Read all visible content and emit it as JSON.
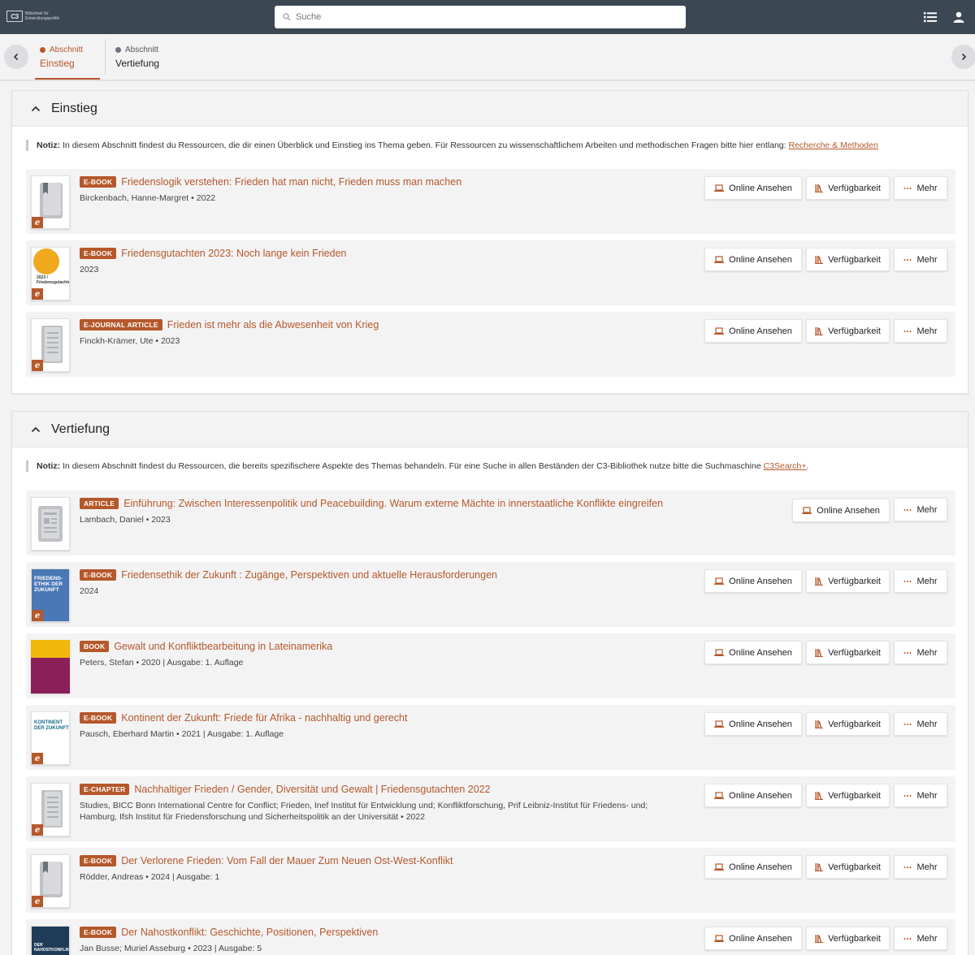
{
  "header": {
    "logo_mark": "C3",
    "logo_text": "Bibliothek für Entwicklungspolitik",
    "search_placeholder": "Suche"
  },
  "section_nav": {
    "tabs": [
      {
        "small": "Abschnitt",
        "label": "Einstieg",
        "dot_color": "#b5582a"
      },
      {
        "small": "Abschnitt",
        "label": "Vertiefung",
        "dot_color": "#6b7380"
      }
    ]
  },
  "buttons": {
    "online": "Online Ansehen",
    "availability": "Verfügbarkeit",
    "more": "Mehr"
  },
  "sections": [
    {
      "title": "Einstieg",
      "note_label": "Notiz:",
      "note_text": " In diesem Abschnitt findest du Ressourcen, die dir einen Überblick und Einstieg ins Thema geben. Für Ressourcen zu wissenschaftlichem Arbeiten und methodischen Fragen bitte hier entlang: ",
      "note_link": "Recherche & Methoden",
      "note_after": "",
      "items": [
        {
          "type": "E-BOOK",
          "title": "Friedenslogik verstehen: Frieden hat man nicht, Frieden muss man machen",
          "authors": "Birckenbach, Hanne-Margret • 2022"
        },
        {
          "type": "E-BOOK",
          "title": "Friedensgutachten 2023: Noch lange kein Frieden",
          "authors": "2023",
          "cover_text": "2023 / Friedensgutachten"
        },
        {
          "type": "E-JOURNAL ARTICLE",
          "title": "Frieden ist mehr als die Abwesenheit von Krieg",
          "authors": "Finckh-Krämer, Ute • 2023"
        }
      ]
    },
    {
      "title": "Vertiefung",
      "note_label": "Notiz:",
      "note_text": " In diesem Abschnitt findest du Ressourcen, die bereits spezifischere Aspekte des Themas behandeln. Für eine Suche in allen Beständen der C3-Bibliothek nutze bitte die Suchmaschine ",
      "note_link": "C3Search+",
      "note_after": ".",
      "items": [
        {
          "type": "ARTICLE",
          "title": "Einführung: Zwischen Interessenpolitik und Peacebuilding. Warum externe Mächte in innerstaatliche Konflikte eingreifen",
          "authors": "Lambach, Daniel • 2023"
        },
        {
          "type": "E-BOOK",
          "title": "Friedensethik der Zukunft : Zugänge, Perspektiven und aktuelle Herausforderungen",
          "authors": "2024",
          "cover_text": "FRIEDENS- ETHIK DER ZUKUNFT"
        },
        {
          "type": "BOOK",
          "title": "Gewalt und Konfliktbearbeitung in Lateinamerika",
          "authors": "Peters, Stefan • 2020 | Ausgabe: 1. Auflage"
        },
        {
          "type": "E-BOOK",
          "title": "Kontinent der Zukunft: Friede für Afrika - nachhaltig und gerecht",
          "authors": "Pausch, Eberhard Martin • 2021 | Ausgabe: 1. Auflage",
          "cover_text": "KONTINENT DER ZUKUNFT"
        },
        {
          "type": "E-CHAPTER",
          "title": "Nachhaltiger Frieden / Gender, Diversität und Gewalt | Friedensgutachten 2022",
          "authors": "Studies, BICC Bonn International Centre for Conflict; Frieden, Inef Institut für Entwicklung und; Konfliktforschung, Prif Leibniz-Institut für Friedens- und; Hamburg, Ifsh Institut für Friedensforschung und Sicherheitspolitik an der Universität • 2022"
        },
        {
          "type": "E-BOOK",
          "title": "Der Verlorene Frieden: Vom Fall der Mauer Zum Neuen Ost-West-Konflikt",
          "authors": "Rödder, Andreas • 2024 | Ausgabe: 1"
        },
        {
          "type": "E-BOOK",
          "title": "Der Nahostkonflikt: Geschichte, Positionen, Perspektiven",
          "authors": "Jan Busse; Muriel Asseburg • 2023 | Ausgabe: 5",
          "cover_text": "DER NAHOSTKONFLIKT"
        }
      ]
    }
  ]
}
